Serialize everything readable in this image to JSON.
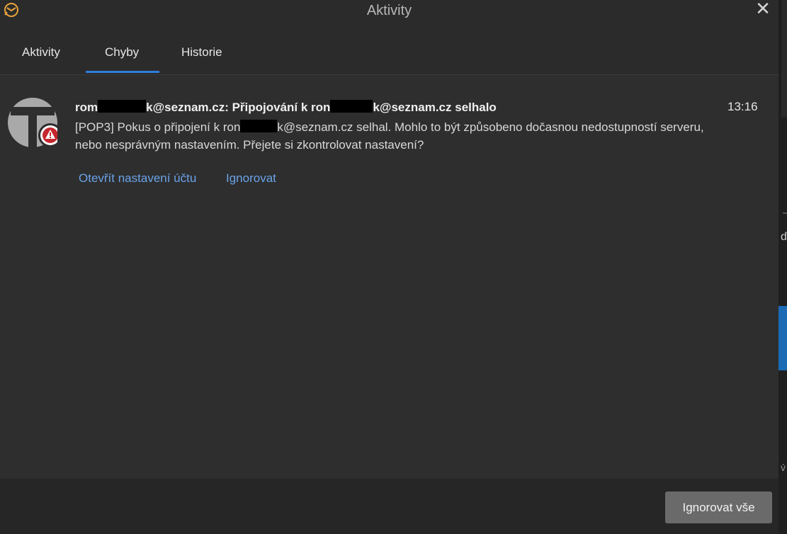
{
  "window": {
    "title": "Aktivity",
    "close_label": "✕"
  },
  "tabs": [
    {
      "label": "Aktivity",
      "active": false
    },
    {
      "label": "Chyby",
      "active": true
    },
    {
      "label": "Historie",
      "active": false
    }
  ],
  "message": {
    "title_part1": "rom",
    "title_part2": "k@seznam.cz: Připojování k ron",
    "title_part3": "k@seznam.cz selhalo",
    "time": "13:16",
    "body_part1": "[POP3] Pokus o připojení k ron",
    "body_part2": "k@seznam.cz selhal. Mohlo to být způsobeno dočasnou nedostupností serveru,",
    "body_line2": "nebo nesprávným nastavením. Přejete si zkontrolovat nastavení?",
    "actions": {
      "open_settings": "Otevřít nastavení účtu",
      "ignore": "Ignorovat"
    }
  },
  "footer": {
    "ignore_all": "Ignorovat vše"
  },
  "background_glyphs": {
    "g1": "ď",
    "g2": "v́"
  },
  "colors": {
    "accent": "#2f7ddc",
    "link": "#6aa3e8",
    "error": "#c6262e",
    "app_icon": "#e8a33a"
  }
}
